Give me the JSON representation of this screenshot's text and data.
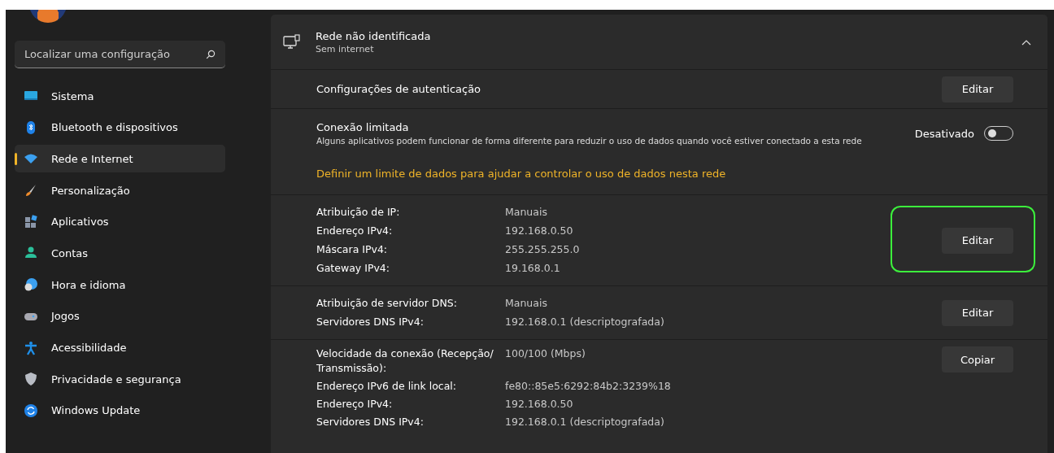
{
  "sidebar": {
    "search": {
      "placeholder": "Localizar uma configuração"
    },
    "items": [
      {
        "label": "Sistema",
        "selected": false
      },
      {
        "label": "Bluetooth e dispositivos",
        "selected": false
      },
      {
        "label": "Rede e Internet",
        "selected": true
      },
      {
        "label": "Personalização",
        "selected": false
      },
      {
        "label": "Aplicativos",
        "selected": false
      },
      {
        "label": "Contas",
        "selected": false
      },
      {
        "label": "Hora e idioma",
        "selected": false
      },
      {
        "label": "Jogos",
        "selected": false
      },
      {
        "label": "Acessibilidade",
        "selected": false
      },
      {
        "label": "Privacidade e segurança",
        "selected": false
      },
      {
        "label": "Windows Update",
        "selected": false
      }
    ]
  },
  "network": {
    "title": "Rede não identificada",
    "subtitle": "Sem internet",
    "expanded": true,
    "auth": {
      "label": "Configurações de autenticação",
      "button": "Editar"
    },
    "metered": {
      "title": "Conexão limitada",
      "description": "Alguns aplicativos podem funcionar de forma diferente para reduzir o uso de dados quando você estiver conectado a esta rede",
      "state_label": "Desativado",
      "on": false,
      "link": "Definir um limite de dados para ajudar a controlar o uso de dados nesta rede"
    },
    "groups": [
      {
        "rows": [
          {
            "label": "Atribuição de IP:",
            "value": "Manuais"
          },
          {
            "label": "Endereço IPv4:",
            "value": "192.168.0.50"
          },
          {
            "label": "Máscara IPv4:",
            "value": "255.255.255.0"
          },
          {
            "label": "Gateway IPv4:",
            "value": "19.168.0.1"
          }
        ],
        "button": "Editar",
        "highlighted": true
      },
      {
        "rows": [
          {
            "label": "Atribuição de servidor DNS:",
            "value": "Manuais"
          },
          {
            "label": "Servidores DNS IPv4:",
            "value": "192.168.0.1 (descriptografada)"
          }
        ],
        "button": "Editar",
        "highlighted": false
      },
      {
        "rows": [
          {
            "label": "Velocidade da conexão (Recepção/ Transmissão):",
            "value": "100/100 (Mbps)"
          },
          {
            "label": "Endereço IPv6 de link local:",
            "value": "fe80::85e5:6292:84b2:3239%18"
          },
          {
            "label": "Endereço IPv4:",
            "value": "192.168.0.50"
          },
          {
            "label": "Servidores DNS IPv4:",
            "value": "192.168.0.1 (descriptografada)"
          }
        ],
        "button": "Copiar",
        "highlighted": false
      }
    ]
  }
}
